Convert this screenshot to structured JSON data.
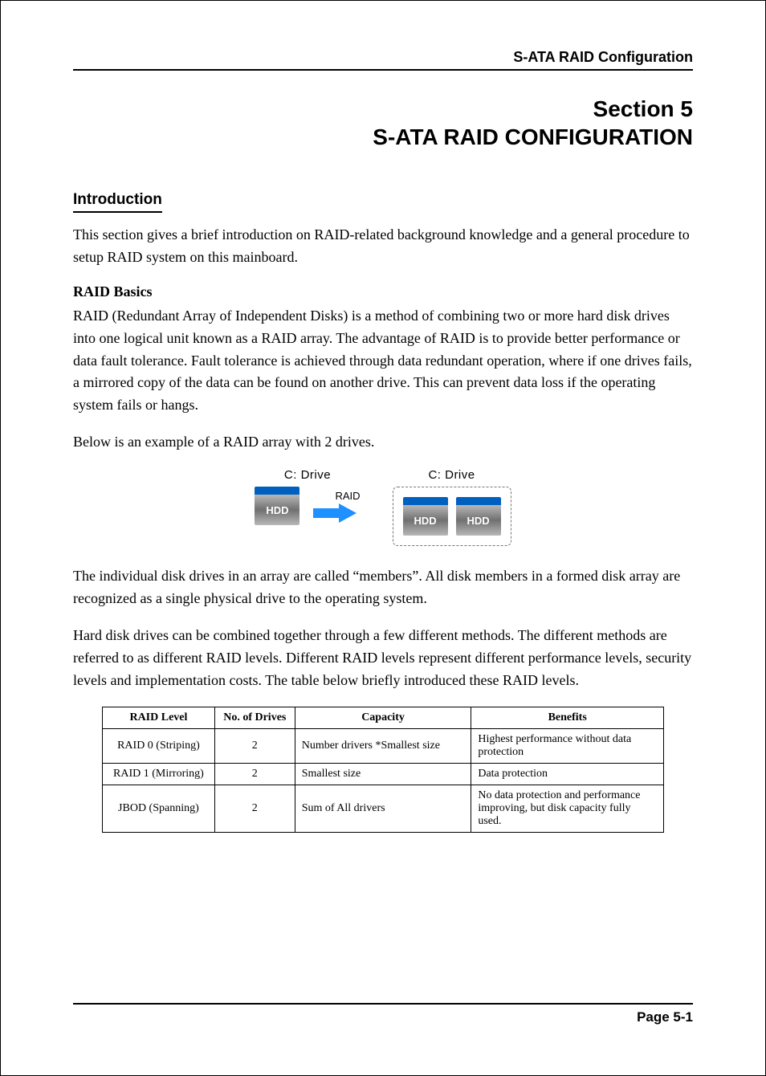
{
  "header": {
    "runningTitle": "S-ATA RAID Configuration"
  },
  "section": {
    "line1": "Section 5",
    "line2": "S-ATA RAID CONFIGURATION"
  },
  "intro": {
    "heading": "Introduction",
    "p1": "This section gives a brief introduction on RAID-related background knowledge and a general procedure to setup RAID system on this mainboard."
  },
  "basics": {
    "heading": "RAID Basics",
    "p1": "RAID (Redundant Array of Independent Disks) is a method of combining two or more hard disk drives into one logical unit known as a RAID array.  The advantage of RAID is to provide better performance or data fault tolerance.  Fault tolerance is achieved through data redundant operation, where if one drives fails, a mirrored copy of the data can be found on another drive.  This can prevent data loss if the operating system fails or hangs.",
    "p2": "Below is an example of a RAID array with 2 drives."
  },
  "figure": {
    "leftDriveLabel": "C: Drive",
    "rightDriveLabel": "C: Drive",
    "hdd": "HDD",
    "raid": "RAID"
  },
  "after": {
    "p1": "The individual disk drives in an array are called “members”.  All disk members in a formed disk array are recognized as a single physical drive to the operating system.",
    "p2": "Hard disk drives can be combined together through a few different methods.  The different methods are referred to as different RAID levels.  Different RAID levels represent different performance levels, security levels and implementation costs.  The table below briefly introduced these RAID levels."
  },
  "table": {
    "headers": {
      "level": "RAID Level",
      "drives": "No. of Drives",
      "capacity": "Capacity",
      "benefits": "Benefits"
    },
    "rows": [
      {
        "level": "RAID 0  (Striping)",
        "drives": "2",
        "capacity": "Number drivers *Smallest size",
        "benefits": "Highest performance without data protection"
      },
      {
        "level": "RAID 1  (Mirroring)",
        "drives": "2",
        "capacity": "Smallest size",
        "benefits": "Data protection"
      },
      {
        "level": "JBOD  (Spanning)",
        "drives": "2",
        "capacity": "Sum of All drivers",
        "benefits": "No data protection and performance improving, but disk capacity fully used."
      }
    ]
  },
  "footer": {
    "page": "Page 5-1"
  }
}
